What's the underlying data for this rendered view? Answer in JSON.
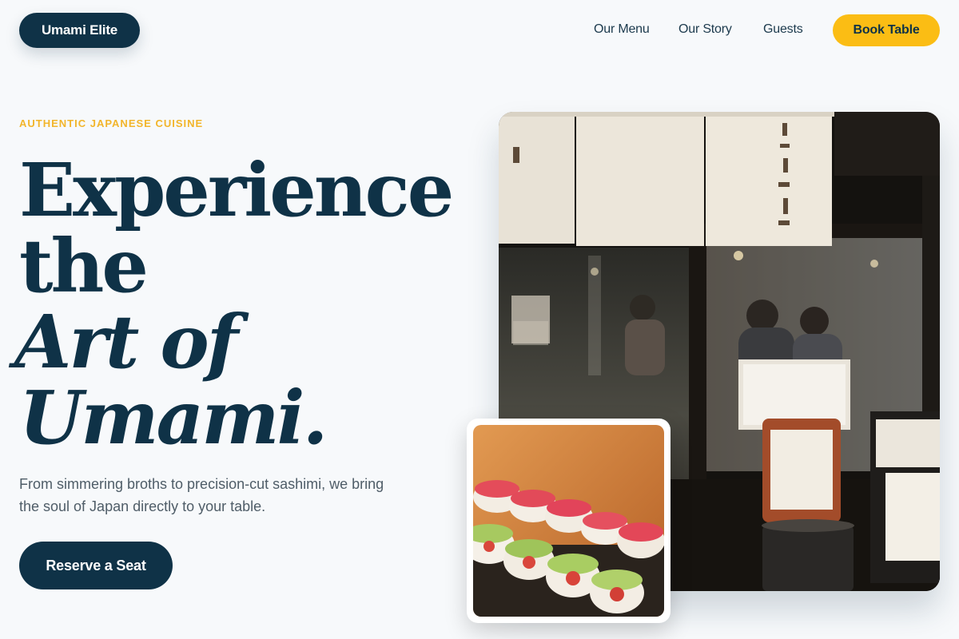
{
  "header": {
    "brand": "Umami Elite",
    "nav": [
      "Our Menu",
      "Our Story",
      "Guests"
    ],
    "cta": "Book Table"
  },
  "hero": {
    "eyebrow": "AUTHENTIC JAPANESE CUISINE",
    "title_lines": [
      "Experience",
      "the",
      "Art of",
      "Umami."
    ],
    "lead": "From simmering broths to precision-cut sashimi, we bring the soul of Japan directly to your table.",
    "cta": "Reserve a Seat"
  },
  "colors": {
    "navy": "#0f3247",
    "accent": "#fbbd14",
    "background": "#f7f9fb"
  }
}
